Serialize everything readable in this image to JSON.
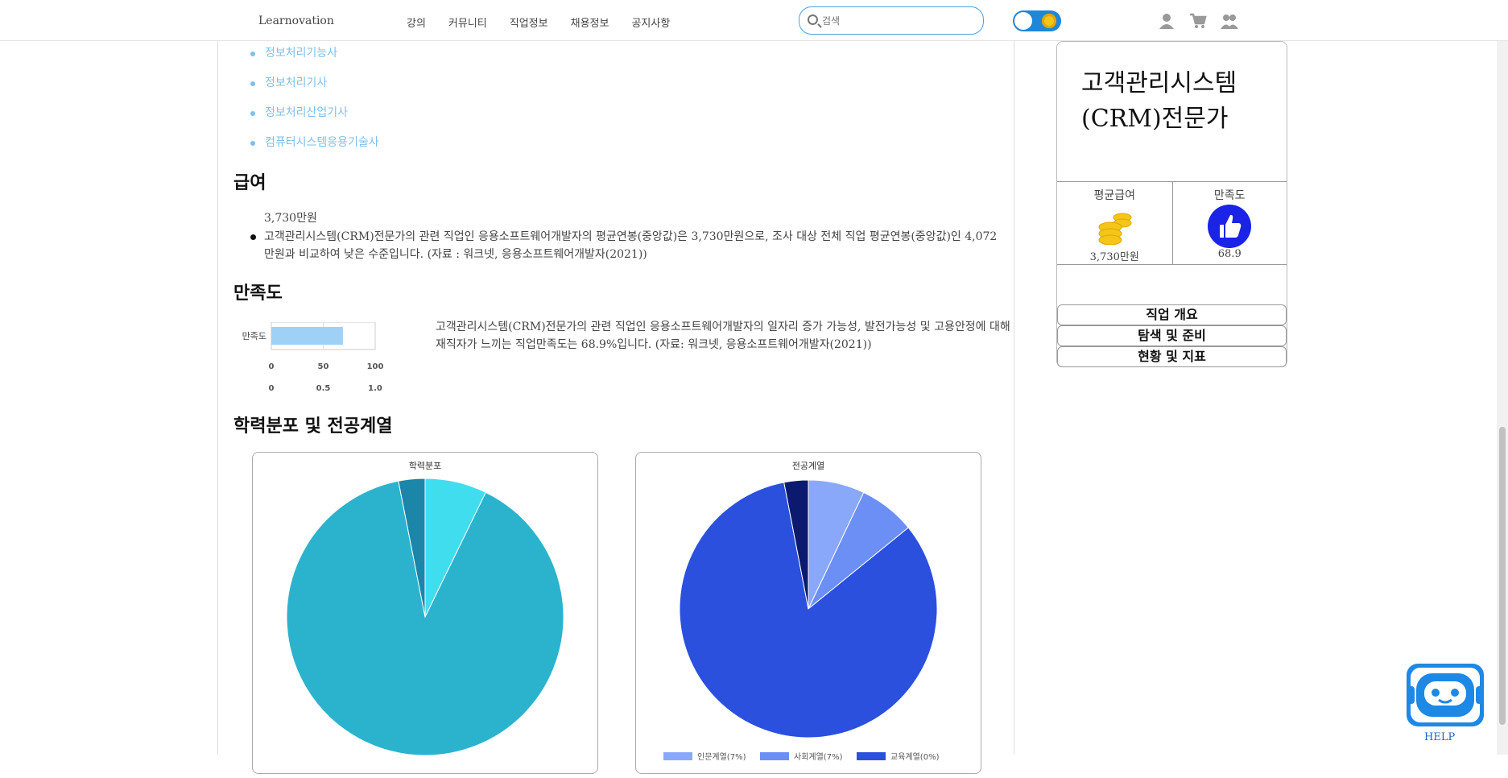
{
  "header": {
    "logo": "Learnovation",
    "nav": [
      "강의",
      "커뮤니티",
      "직업정보",
      "채용정보",
      "공지사항"
    ],
    "search_placeholder": "검색"
  },
  "certifications": [
    "정보처리기능사",
    "정보처리기사",
    "정보처리산업기사",
    "컴퓨터시스템응용기술사"
  ],
  "salary": {
    "heading": "급여",
    "amount": "3,730만원",
    "description": "고객관리시스템(CRM)전문가의 관련 직업인 응용소프트웨어개발자의 평균연봉(중앙값)은 3,730만원으로, 조사 대상 전체 직업 평균연봉(중앙값)인 4,072만원과 비교하여 낮은 수준입니다. (자료 : 워크넷, 응용소프트웨어개발자(2021))"
  },
  "satisfaction": {
    "heading": "만족도",
    "description": "고객관리시스템(CRM)전문가의 관련 직업인 응용소프트웨어개발자의 일자리 증가 가능성, 발전가능성 및 고용안정에 대해 재직자가 느끼는 직업만족도는 68.9%입니다. (자료: 워크넷, 응용소프트웨어개발자(2021))"
  },
  "education": {
    "heading": "학력분포 및 전공계열"
  },
  "chart_data": [
    {
      "type": "bar",
      "orientation": "horizontal",
      "categories": [
        "만족도"
      ],
      "values": [
        68.9
      ],
      "xlim": [
        0,
        100
      ],
      "xticks": [
        "0",
        "50",
        "100"
      ],
      "x2ticks": [
        "0",
        "0.5",
        "1.0"
      ],
      "color": "#9fd0f5"
    },
    {
      "type": "pie",
      "title": "학력분포",
      "values": [
        7,
        87,
        3
      ],
      "colors": [
        "#3fdded",
        "#2bb3ce",
        "#1c86a8"
      ]
    },
    {
      "type": "pie",
      "title": "전공계열",
      "values": [
        7,
        7,
        82,
        3
      ],
      "colors": [
        "#8aa8fa",
        "#6b8ff5",
        "#2b50de",
        "#0b1a6e"
      ],
      "legend": [
        "인문계열(7%)",
        "사회계열(7%)",
        "교육계열(0%)"
      ],
      "legend_position": "bottom"
    }
  ],
  "card": {
    "title": "고객관리시스템(CRM)전문가",
    "avg_salary_label": "평균급여",
    "avg_salary_value": "3,730만원",
    "satisfaction_label": "만족도",
    "satisfaction_value": "68.9",
    "menu": [
      "직업 개요",
      "탐색 및 준비",
      "현황 및 지표"
    ]
  },
  "help": {
    "label": "HELP"
  },
  "colors": {
    "link": "#7fbfe9",
    "accent": "#1f86d8",
    "thumb": "#1a23e6",
    "coin": "#f5c518"
  }
}
